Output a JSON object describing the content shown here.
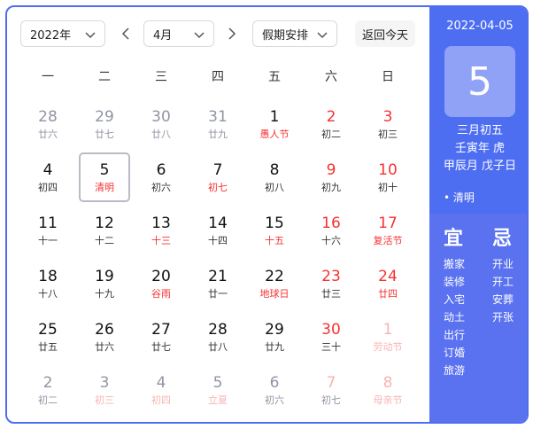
{
  "toolbar": {
    "year": "2022年",
    "month": "4月",
    "holiday": "假期安排",
    "today": "返回今天"
  },
  "weekdays": [
    "一",
    "二",
    "三",
    "四",
    "五",
    "六",
    "日"
  ],
  "days": [
    {
      "n": "28",
      "s": "廿六",
      "other": true
    },
    {
      "n": "29",
      "s": "廿七",
      "other": true
    },
    {
      "n": "30",
      "s": "廿八",
      "other": true
    },
    {
      "n": "31",
      "s": "廿九",
      "other": true
    },
    {
      "n": "1",
      "s": "愚人节",
      "fest": true
    },
    {
      "n": "2",
      "s": "初二",
      "weekend": true
    },
    {
      "n": "3",
      "s": "初三",
      "weekend": true
    },
    {
      "n": "4",
      "s": "初四"
    },
    {
      "n": "5",
      "s": "清明",
      "fest": true,
      "selected": true
    },
    {
      "n": "6",
      "s": "初六"
    },
    {
      "n": "7",
      "s": "初七",
      "fest": true
    },
    {
      "n": "8",
      "s": "初八"
    },
    {
      "n": "9",
      "s": "初九",
      "weekend": true
    },
    {
      "n": "10",
      "s": "初十",
      "weekend": true
    },
    {
      "n": "11",
      "s": "十一"
    },
    {
      "n": "12",
      "s": "十二"
    },
    {
      "n": "13",
      "s": "十三",
      "fest": true
    },
    {
      "n": "14",
      "s": "十四"
    },
    {
      "n": "15",
      "s": "十五",
      "fest": true
    },
    {
      "n": "16",
      "s": "十六",
      "weekend": true
    },
    {
      "n": "17",
      "s": "复活节",
      "weekend": true,
      "fest": true
    },
    {
      "n": "18",
      "s": "十八"
    },
    {
      "n": "19",
      "s": "十九"
    },
    {
      "n": "20",
      "s": "谷雨",
      "fest": true
    },
    {
      "n": "21",
      "s": "廿一"
    },
    {
      "n": "22",
      "s": "地球日",
      "fest": true
    },
    {
      "n": "23",
      "s": "廿三",
      "weekend": true
    },
    {
      "n": "24",
      "s": "廿四",
      "weekend": true,
      "fest": true
    },
    {
      "n": "25",
      "s": "廿五"
    },
    {
      "n": "26",
      "s": "廿六"
    },
    {
      "n": "27",
      "s": "廿七"
    },
    {
      "n": "28",
      "s": "廿八"
    },
    {
      "n": "29",
      "s": "廿九"
    },
    {
      "n": "30",
      "s": "三十",
      "weekend": true
    },
    {
      "n": "1",
      "s": "劳动节",
      "other": true,
      "weekend": true,
      "fest": true
    },
    {
      "n": "2",
      "s": "初二",
      "other": true
    },
    {
      "n": "3",
      "s": "初三",
      "other": true,
      "fest": true
    },
    {
      "n": "4",
      "s": "初四",
      "other": true,
      "fest": true
    },
    {
      "n": "5",
      "s": "立夏",
      "other": true,
      "fest": true
    },
    {
      "n": "6",
      "s": "初六",
      "other": true
    },
    {
      "n": "7",
      "s": "初七",
      "other": true,
      "weekend": true
    },
    {
      "n": "8",
      "s": "母亲节",
      "other": true,
      "weekend": true,
      "fest": true
    }
  ],
  "side": {
    "date": "2022-04-05",
    "day": "5",
    "lunar1": "三月初五",
    "lunar2": "壬寅年 虎",
    "lunar3": "甲辰月 戊子日",
    "term": "• 清明",
    "yi_title": "宜",
    "ji_title": "忌",
    "yi": [
      "搬家",
      "装修",
      "入宅",
      "动土",
      "出行",
      "订婚",
      "旅游"
    ],
    "ji": [
      "开业",
      "开工",
      "安葬",
      "开张"
    ]
  },
  "colors": {
    "accent": "#4e6ef2",
    "holiday_red": "#f73131",
    "muted": "#9195a3"
  }
}
